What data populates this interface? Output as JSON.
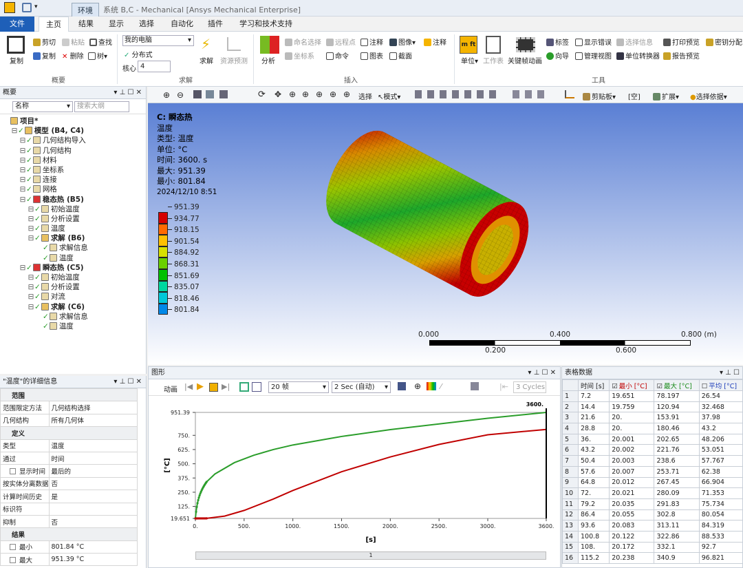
{
  "title_bar": {
    "context_tab": "环境",
    "window_title": "系统 B,C - Mechanical [Ansys Mechanical Enterprise]"
  },
  "menu_tabs": [
    "文件",
    "主页",
    "结果",
    "显示",
    "选择",
    "自动化",
    "插件",
    "学习和技术支持"
  ],
  "ribbon": {
    "outline_group": {
      "copy": "复制",
      "cut": "剪切",
      "paste": "粘贴",
      "find": "查找",
      "duplicate": "复制",
      "delete": "删除",
      "tree": "树",
      "label": "概要"
    },
    "solve_group": {
      "machine": "我的电脑",
      "distributed": "分布式",
      "cores_label": "核心",
      "cores_value": "4",
      "solve": "求解",
      "resource": "资源预测",
      "label": "求解"
    },
    "insert_group": {
      "analysis": "分析",
      "named_sel": "命名选择",
      "remote_point": "远程点",
      "comment": "注释",
      "image": "图像",
      "annotation": "注释",
      "coord": "坐标系",
      "command": "命令",
      "chart": "图表",
      "section": "截面",
      "label": "插入"
    },
    "tools_group": {
      "units": "单位",
      "worksheet": "工作表",
      "keyframe": "关键帧动画",
      "tag": "标签",
      "show_errors": "显示错误",
      "select_info": "选择信息",
      "print_preview": "打印预览",
      "key": "密钥分配",
      "wizard": "向导",
      "manage_views": "管理视图",
      "unit_conv": "单位转换器",
      "report": "报告预览",
      "label": "工具"
    }
  },
  "toolbar": {
    "select": "选择",
    "mode": "模式",
    "clipboard": "剪贴板",
    "empty": "[空]",
    "extend": "扩展",
    "select_by": "选择依据"
  },
  "outline": {
    "title": "概要",
    "name_col": "名称",
    "search_placeholder": "搜索大纲",
    "items": [
      {
        "label": "项目*",
        "level": 0,
        "bold": true
      },
      {
        "label": "模型 (B4, C4)",
        "level": 1,
        "bold": true
      },
      {
        "label": "几何结构导入",
        "level": 2
      },
      {
        "label": "几何结构",
        "level": 2
      },
      {
        "label": "材料",
        "level": 2
      },
      {
        "label": "坐标系",
        "level": 2
      },
      {
        "label": "连接",
        "level": 2
      },
      {
        "label": "网格",
        "level": 2
      },
      {
        "label": "稳态热 (B5)",
        "level": 2,
        "bold": true
      },
      {
        "label": "初始温度",
        "level": 3
      },
      {
        "label": "分析设置",
        "level": 3
      },
      {
        "label": "温度",
        "level": 3
      },
      {
        "label": "求解 (B6)",
        "level": 3,
        "bold": true
      },
      {
        "label": "求解信息",
        "level": 4
      },
      {
        "label": "温度",
        "level": 4
      },
      {
        "label": "瞬态热 (C5)",
        "level": 2,
        "bold": true
      },
      {
        "label": "初始温度",
        "level": 3
      },
      {
        "label": "分析设置",
        "level": 3
      },
      {
        "label": "对流",
        "level": 3
      },
      {
        "label": "求解 (C6)",
        "level": 3,
        "bold": true
      },
      {
        "label": "求解信息",
        "level": 4
      },
      {
        "label": "温度",
        "level": 4
      }
    ]
  },
  "details": {
    "title": "\"温度\"的详细信息",
    "rows": [
      {
        "section": "范围"
      },
      {
        "k": "范围限定方法",
        "v": "几何结构选择"
      },
      {
        "k": "几何结构",
        "v": "所有几何体"
      },
      {
        "section": "定义"
      },
      {
        "k": "类型",
        "v": "温度"
      },
      {
        "k": "通过",
        "v": "时间"
      },
      {
        "k": "显示时间",
        "v": "最后的",
        "check": true
      },
      {
        "k": "按实体分离数据",
        "v": "否"
      },
      {
        "k": "计算时间历史",
        "v": "是"
      },
      {
        "k": "标识符",
        "v": ""
      },
      {
        "k": "抑制",
        "v": "否"
      },
      {
        "section": "结果"
      },
      {
        "k": "最小",
        "v": "801.84 °C",
        "check": true
      },
      {
        "k": "最大",
        "v": "951.39 °C",
        "check": true
      }
    ]
  },
  "viewport": {
    "line1": "C: 瞬态热",
    "line2": "温度",
    "line3": "类型: 温度",
    "line4": "单位: °C",
    "line5": "时间: 3600. s",
    "line6": "最大: 951.39",
    "line7": "最小: 801.84",
    "line8": "2024/12/10 8:51",
    "legend": [
      "951.39",
      "934.77",
      "918.15",
      "901.54",
      "884.92",
      "868.31",
      "851.69",
      "835.07",
      "818.46",
      "801.84"
    ],
    "legend_colors": [
      "#d40000",
      "#ff6a00",
      "#ffc000",
      "#d8e000",
      "#6ad000",
      "#00c000",
      "#00d8a0",
      "#00c8d8",
      "#0088e8",
      "#0010d0"
    ],
    "scale_top": [
      "0.000",
      "0.400",
      "0.800 (m)"
    ],
    "scale_bottom": [
      "0.200",
      "0.600"
    ]
  },
  "graph": {
    "title": "图形",
    "animation": "动画",
    "frames": "20 帧",
    "duration": "2 Sec (自动)",
    "cycles": "3 Cycles",
    "page": "1"
  },
  "chart_data": {
    "type": "line",
    "xlabel": "[s]",
    "ylabel": "[°C]",
    "ylim": [
      19.651,
      951.39
    ],
    "xlim": [
      0,
      3600
    ],
    "yticks": [
      "951.39",
      "750.",
      "625.",
      "500.",
      "375.",
      "250.",
      "125.",
      "19.651"
    ],
    "xticks": [
      "0.",
      "500.",
      "1000.",
      "1500.",
      "2000.",
      "2500.",
      "3000.",
      "3600."
    ],
    "marker": "3600.",
    "series": [
      {
        "name": "最大",
        "color": "#2a9d2a",
        "x": [
          0,
          7.2,
          14.4,
          21.6,
          28.8,
          36,
          43.2,
          50.4,
          57.6,
          64.8,
          72,
          79.2,
          86.4,
          93.6,
          100.8,
          108,
          115.2,
          200,
          400,
          600,
          800,
          1000,
          1500,
          2000,
          2500,
          3000,
          3600
        ],
        "values": [
          19.651,
          78.197,
          120.94,
          153.91,
          180.46,
          202.65,
          221.76,
          238.6,
          253.71,
          267.45,
          280.09,
          291.83,
          302.8,
          313.11,
          322.86,
          332.1,
          340.9,
          410,
          510,
          575,
          625,
          665,
          740,
          800,
          850,
          900,
          951.39
        ]
      },
      {
        "name": "最小",
        "color": "#c00000",
        "x": [
          0,
          7.2,
          14.4,
          21.6,
          28.8,
          36,
          43.2,
          50.4,
          57.6,
          64.8,
          72,
          79.2,
          86.4,
          93.6,
          100.8,
          108,
          115.2,
          300,
          500,
          800,
          1000,
          1500,
          2000,
          2500,
          3000,
          3600
        ],
        "values": [
          19.651,
          19.651,
          19.759,
          20,
          20,
          20.001,
          20.002,
          20.003,
          20.007,
          20.012,
          20.021,
          20.035,
          20.055,
          20.083,
          20.122,
          20.172,
          20.238,
          40,
          90,
          190,
          265,
          430,
          560,
          670,
          755,
          801.84
        ]
      }
    ]
  },
  "table": {
    "title": "表格数据",
    "headers": [
      "时间 [s]",
      "最小 [°C]",
      "最大 [°C]",
      "平均 [°C]"
    ],
    "rows": [
      [
        "1",
        "7.2",
        "19.651",
        "78.197",
        "26.54"
      ],
      [
        "2",
        "14.4",
        "19.759",
        "120.94",
        "32.468"
      ],
      [
        "3",
        "21.6",
        "20.",
        "153.91",
        "37.98"
      ],
      [
        "4",
        "28.8",
        "20.",
        "180.46",
        "43.2"
      ],
      [
        "5",
        "36.",
        "20.001",
        "202.65",
        "48.206"
      ],
      [
        "6",
        "43.2",
        "20.002",
        "221.76",
        "53.051"
      ],
      [
        "7",
        "50.4",
        "20.003",
        "238.6",
        "57.767"
      ],
      [
        "8",
        "57.6",
        "20.007",
        "253.71",
        "62.38"
      ],
      [
        "9",
        "64.8",
        "20.012",
        "267.45",
        "66.904"
      ],
      [
        "10",
        "72.",
        "20.021",
        "280.09",
        "71.353"
      ],
      [
        "11",
        "79.2",
        "20.035",
        "291.83",
        "75.734"
      ],
      [
        "12",
        "86.4",
        "20.055",
        "302.8",
        "80.054"
      ],
      [
        "13",
        "93.6",
        "20.083",
        "313.11",
        "84.319"
      ],
      [
        "14",
        "100.8",
        "20.122",
        "322.86",
        "88.533"
      ],
      [
        "15",
        "108.",
        "20.172",
        "332.1",
        "92.7"
      ],
      [
        "16",
        "115.2",
        "20.238",
        "340.9",
        "96.821"
      ]
    ]
  }
}
